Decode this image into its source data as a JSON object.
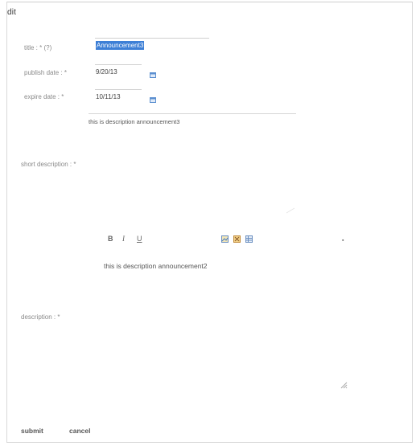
{
  "panel": {
    "title": "dit"
  },
  "form": {
    "title_label": "title : * (?)",
    "title_value": "Announcement3",
    "publish_label": "publish date : *",
    "publish_value": "9/20/13",
    "expire_label": "expire date : *",
    "expire_value": "10/11/13",
    "short_desc_label": "short description : *",
    "short_desc_value": "this is description announcement3",
    "description_label": "description : *"
  },
  "editor": {
    "bold": "B",
    "italic": "I",
    "underline": "U",
    "content": "this is description announcement2"
  },
  "actions": {
    "submit": "submit",
    "cancel": "cancel"
  },
  "colors": {
    "selection": "#3d7fd6",
    "calendar_icon": "#5b8fd0"
  }
}
